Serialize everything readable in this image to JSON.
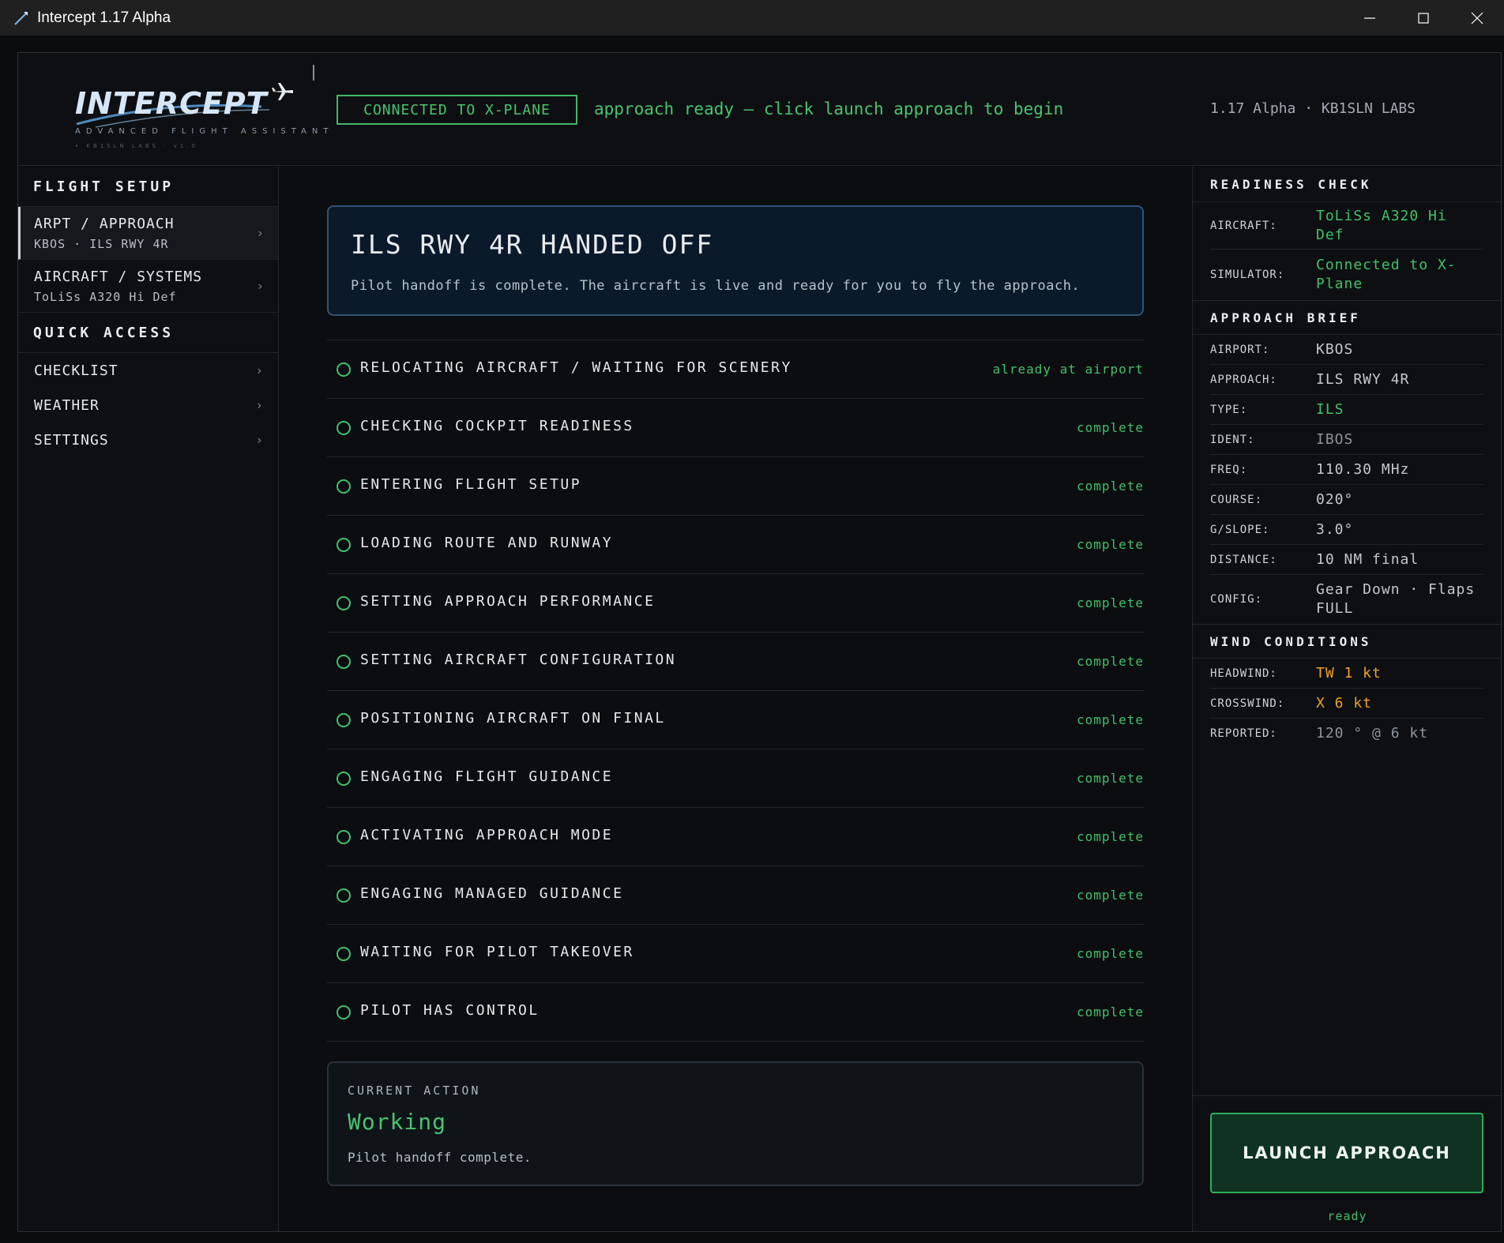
{
  "window": {
    "title": "Intercept 1.17 Alpha"
  },
  "header": {
    "logo_word": "INTERCEPT",
    "logo_tagline": "ADVANCED FLIGHT ASSISTANT",
    "logo_subtag": "• KB1SLN LABS · v1.0",
    "connection_badge": "CONNECTED TO X-PLANE",
    "status_message": "approach ready — click launch approach to begin",
    "version": "1.17 Alpha · KB1SLN LABS"
  },
  "sidebar": {
    "flight_setup_heading": "FLIGHT SETUP",
    "flight_setup_items": [
      {
        "label": "ARPT / APPROACH",
        "sub": "KBOS · ILS RWY 4R"
      },
      {
        "label": "AIRCRAFT / SYSTEMS",
        "sub": "ToLiSs A320 Hi Def"
      }
    ],
    "quick_access_heading": "QUICK ACCESS",
    "quick_access_items": [
      {
        "label": "CHECKLIST"
      },
      {
        "label": "WEATHER"
      },
      {
        "label": "SETTINGS"
      }
    ],
    "chevron": "›"
  },
  "main": {
    "banner_title": "ILS RWY 4R HANDED OFF",
    "banner_subtitle": "Pilot handoff is complete. The aircraft is live and ready for you to fly the approach.",
    "steps": [
      {
        "label": "RELOCATING AIRCRAFT / WAITING FOR SCENERY",
        "status": "already at airport"
      },
      {
        "label": "CHECKING COCKPIT READINESS",
        "status": "complete"
      },
      {
        "label": "ENTERING FLIGHT SETUP",
        "status": "complete"
      },
      {
        "label": "LOADING ROUTE AND RUNWAY",
        "status": "complete"
      },
      {
        "label": "SETTING APPROACH PERFORMANCE",
        "status": "complete"
      },
      {
        "label": "SETTING AIRCRAFT CONFIGURATION",
        "status": "complete"
      },
      {
        "label": "POSITIONING AIRCRAFT ON FINAL",
        "status": "complete"
      },
      {
        "label": "ENGAGING FLIGHT GUIDANCE",
        "status": "complete"
      },
      {
        "label": "ACTIVATING APPROACH MODE",
        "status": "complete"
      },
      {
        "label": "ENGAGING MANAGED GUIDANCE",
        "status": "complete"
      },
      {
        "label": "WAITING FOR PILOT TAKEOVER",
        "status": "complete"
      },
      {
        "label": "PILOT HAS CONTROL",
        "status": "complete"
      }
    ],
    "current_action": {
      "heading": "CURRENT ACTION",
      "value": "Working",
      "detail": "Pilot handoff complete."
    }
  },
  "right_panel": {
    "readiness_heading": "READINESS CHECK",
    "readiness": [
      {
        "key": "AIRCRAFT:",
        "value": "ToLiSs A320 Hi Def"
      },
      {
        "key": "SIMULATOR:",
        "value": "Connected to X-Plane"
      }
    ],
    "brief_heading": "APPROACH BRIEF",
    "brief": [
      {
        "key": "AIRPORT:",
        "value": "KBOS"
      },
      {
        "key": "APPROACH:",
        "value": "ILS RWY 4R"
      },
      {
        "key": "TYPE:",
        "value": "ILS"
      },
      {
        "key": "IDENT:",
        "value": "IBOS"
      },
      {
        "key": "FREQ:",
        "value": "110.30 MHz"
      },
      {
        "key": "COURSE:",
        "value": "020°"
      },
      {
        "key": "G/SLOPE:",
        "value": "3.0°"
      },
      {
        "key": "DISTANCE:",
        "value": "10 NM final"
      },
      {
        "key": "CONFIG:",
        "value": "Gear Down · Flaps FULL"
      }
    ],
    "wind_heading": "WIND CONDITIONS",
    "wind": [
      {
        "key": "HEADWIND:",
        "value": "TW 1 kt"
      },
      {
        "key": "CROSSWIND:",
        "value": "X 6 kt"
      },
      {
        "key": "REPORTED:",
        "value": "120 ° @ 6 kt"
      }
    ],
    "launch_button": "LAUNCH APPROACH",
    "launch_status": "ready"
  },
  "colors": {
    "accent_green": "#43c06a",
    "warning_orange": "#f0a030",
    "banner_border": "#2f5378"
  }
}
